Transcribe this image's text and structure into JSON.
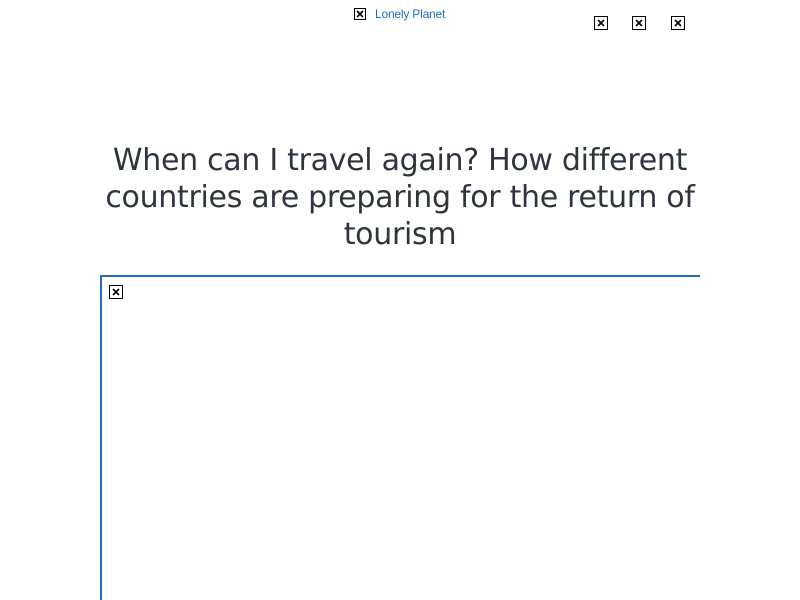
{
  "header": {
    "logo_text": "Lonely Planet",
    "logo_icon": "broken-image-icon",
    "icons": [
      "broken-image-icon",
      "broken-image-icon",
      "broken-image-icon"
    ]
  },
  "article": {
    "headline": "When can I travel again? How different countries are preparing for the return of tourism",
    "hero_image_icon": "broken-image-icon"
  },
  "colors": {
    "accent": "#1f6fc5",
    "link": "#1a6fbf",
    "headline_text": "#2d3640",
    "background": "#ffffff"
  }
}
